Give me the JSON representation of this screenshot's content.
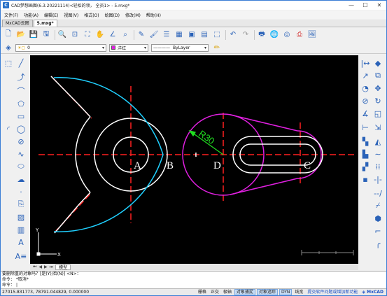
{
  "window": {
    "title": "CAD梦想画图(6.3.20221114)<轻松的领，  全员1> - 5.mxg*",
    "controls": [
      "—",
      "☐",
      "✕"
    ]
  },
  "menu": [
    "文件(F)",
    "功能(A)",
    "编辑(E)",
    "视图(V)",
    "格式(O)",
    "绘图(D)",
    "修改(M)",
    "帮助(H)"
  ],
  "doc_tabs": [
    "MxCAD云图",
    "5.mxg*"
  ],
  "properties": {
    "layer_value": "0",
    "color_value": "洋红",
    "linetype_value": "ByLayer",
    "linetype_sample": "————"
  },
  "canvas": {
    "colors": {
      "background": "#000000",
      "centerline": "#ff2020",
      "white": "#ffffff",
      "cyan": "#20d0ff",
      "magenta": "#e020e0",
      "dim": "#20e020"
    },
    "labels": {
      "a": "A",
      "b": "B",
      "c": "C",
      "d": "D",
      "dim": "R30"
    },
    "ucs": {
      "x": "X",
      "y": "Y"
    }
  },
  "layout_tabs": {
    "model": "模型"
  },
  "command": {
    "line1": "要删除重的对象吗？[是(Y)/否(N)] <N>：",
    "line2": "命令：  *取消*",
    "prompt": "命令："
  },
  "status": {
    "coords": "27015.831773,  78791.044829,  0.000000",
    "buttons": [
      {
        "label": "栅格",
        "on": false
      },
      {
        "label": "正交",
        "on": false
      },
      {
        "label": "极轴",
        "on": false
      },
      {
        "label": "对象捕捉",
        "on": true
      },
      {
        "label": "对象追踪",
        "on": true
      },
      {
        "label": "DYN",
        "on": true
      },
      {
        "label": "线宽",
        "on": false
      }
    ],
    "link": "提交软件问题或增加新功能",
    "brand": "MxCAD"
  }
}
